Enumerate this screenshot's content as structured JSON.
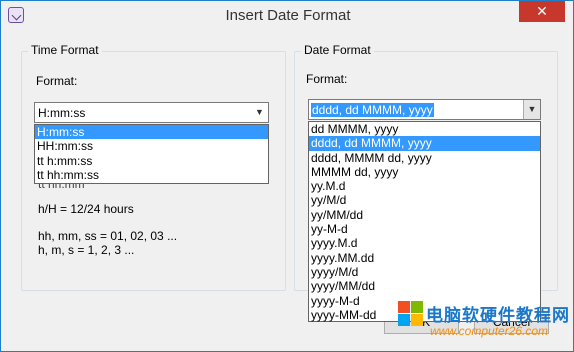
{
  "window": {
    "title": "Insert Date Format",
    "close_glyph": "✕",
    "accent_color": "#c7372c"
  },
  "time_format": {
    "group_title": "Time Format",
    "format_label": "Format:",
    "selected_value": "H:mm:ss",
    "options": [
      "H:mm:ss",
      "HH:mm:ss",
      "tt h:mm:ss",
      "tt hh:mm:ss"
    ],
    "selected_index": 0,
    "partial_behind_dropdown": "tt hh:mm",
    "help_lines": [
      "h/H = 12/24 hours",
      "hh, mm, ss = 01, 02, 03 ...",
      "h, m, s = 1, 2, 3 ..."
    ]
  },
  "date_format": {
    "group_title": "Date Format",
    "format_label": "Format:",
    "selected_value": "dddd, dd MMMM, yyyy",
    "options": [
      "dd MMMM, yyyy",
      "dddd, dd MMMM, yyyy",
      "dddd, MMMM dd, yyyy",
      "MMMM dd, yyyy",
      "yy.M.d",
      "yy/M/d",
      "yy/MM/dd",
      "yy-M-d",
      "yyyy.M.d",
      "yyyy.MM.dd",
      "yyyy/M/d",
      "yyyy/MM/dd",
      "yyyy-M-d",
      "yyyy-MM-dd"
    ],
    "selected_index": 1
  },
  "buttons": {
    "ok_label": "OK",
    "cancel_label": "Cancel"
  },
  "watermark": {
    "text": "电脑软硬件教程网",
    "url": "www.computer26.com",
    "logo_colors": [
      "#f25022",
      "#7fba00",
      "#00a4ef",
      "#ffb900"
    ]
  },
  "icons": {
    "app": "app-icon",
    "dropdown_arrow": "chevron-down-icon",
    "close": "close-icon"
  }
}
